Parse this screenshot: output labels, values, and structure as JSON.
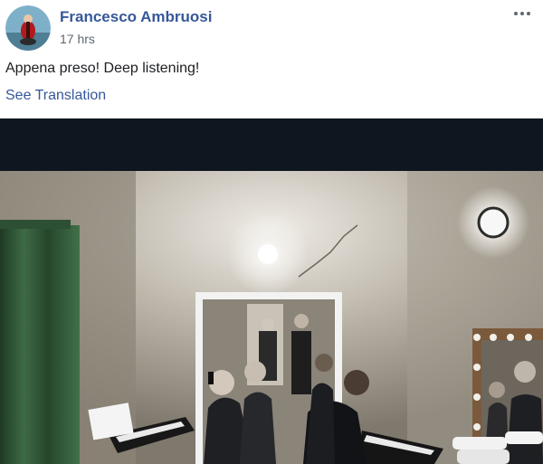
{
  "post": {
    "author": "Francesco Ambruosi",
    "timestamp": "17 hrs",
    "text": "Appena preso! Deep listening!",
    "translate_link": "See Translation",
    "more_icon": "more-horizontal-icon"
  },
  "colors": {
    "link_blue": "#365899",
    "meta_gray": "#606770",
    "text": "#1c1e21",
    "photo_top_band": "#0f1620"
  }
}
